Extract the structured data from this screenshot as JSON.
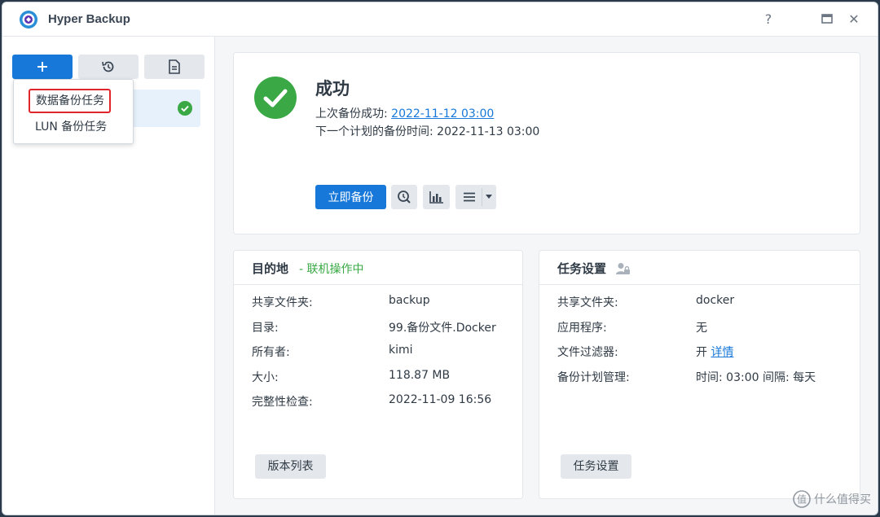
{
  "window": {
    "title": "Hyper Backup",
    "help": "?",
    "maximize": "🗖",
    "close": "✕"
  },
  "colors": {
    "accent": "#1778d9",
    "success": "#3aa844",
    "highlight_border": "#e0262b"
  },
  "sidebar": {
    "toolbar": {
      "add_icon": "plus-icon",
      "restore_icon": "history-icon",
      "log_icon": "document-icon"
    },
    "dropdown": {
      "items": [
        {
          "label": "数据备份任务"
        },
        {
          "label": "LUN 备份任务"
        }
      ]
    },
    "task_status_icon": "check-circle-icon"
  },
  "status": {
    "title": "成功",
    "last_label": "上次备份成功: ",
    "last_value": "2022-11-12 03:00",
    "next_label": "下一个计划的备份时间: 2022-11-13 03:00",
    "backup_now": "立即备份"
  },
  "destination": {
    "title": "目的地",
    "status": "- 联机操作中",
    "rows": [
      {
        "label": "共享文件夹:",
        "value": "backup"
      },
      {
        "label": "目录:",
        "value": "99.备份文件.Docker"
      },
      {
        "label": "所有者:",
        "value": "kimi"
      },
      {
        "label": "大小:",
        "value": "118.87 MB"
      },
      {
        "label": "完整性检查:",
        "value": "2022-11-09 16:56"
      }
    ],
    "button": "版本列表"
  },
  "task_settings": {
    "title": "任务设置",
    "rows": [
      {
        "label": "共享文件夹:",
        "value": "docker"
      },
      {
        "label": "应用程序:",
        "value": "无"
      },
      {
        "label": "文件过滤器:",
        "value": "开",
        "link": "详情"
      },
      {
        "label": "备份计划管理:",
        "value": "时间: 03:00 间隔: 每天"
      }
    ],
    "button": "任务设置"
  },
  "watermark": {
    "text": "什么值得买",
    "icon": "zhi-icon"
  }
}
